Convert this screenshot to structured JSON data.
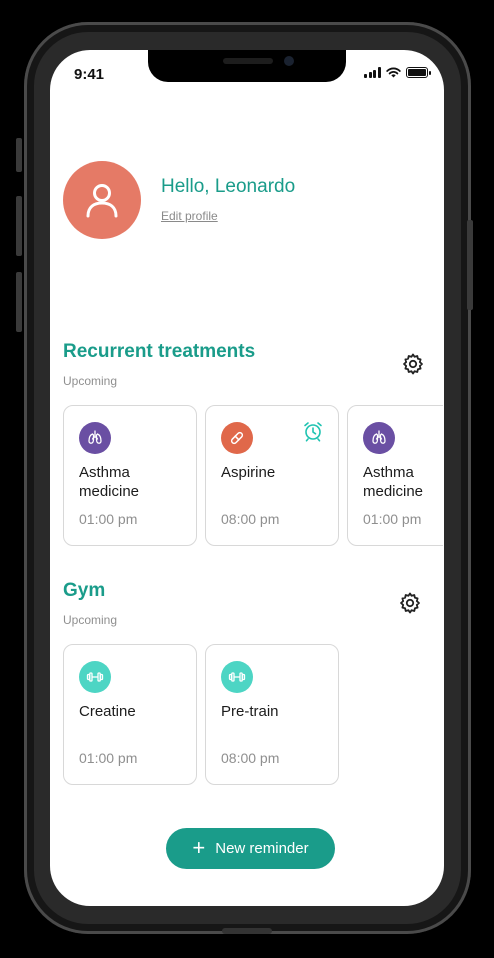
{
  "status_bar": {
    "time": "9:41"
  },
  "profile": {
    "greeting": "Hello, Leonardo",
    "edit_label": "Edit profile"
  },
  "colors": {
    "accent": "#1a9c8a",
    "avatar": "#e57a66",
    "purple": "#6a4fa3",
    "orange": "#e0684a",
    "mint": "#4dd5c4"
  },
  "sections": {
    "recurrent": {
      "title": "Recurrent treatments",
      "subtitle": "Upcoming",
      "cards": [
        {
          "icon": "lungs-icon",
          "name": "Asthma medicine",
          "time": "01:00 pm"
        },
        {
          "icon": "pill-icon",
          "name": "Aspirine",
          "time": "08:00 pm",
          "badge": "alarm-icon"
        },
        {
          "icon": "lungs-icon",
          "name": "Asthma medicine",
          "time": "01:00 pm"
        }
      ]
    },
    "gym": {
      "title": "Gym",
      "subtitle": "Upcoming",
      "cards": [
        {
          "icon": "dumbbell-icon",
          "name": "Creatine",
          "time": "01:00 pm"
        },
        {
          "icon": "dumbbell-icon",
          "name": "Pre-train",
          "time": "08:00 pm"
        }
      ]
    }
  },
  "actions": {
    "new_reminder": "New reminder"
  }
}
